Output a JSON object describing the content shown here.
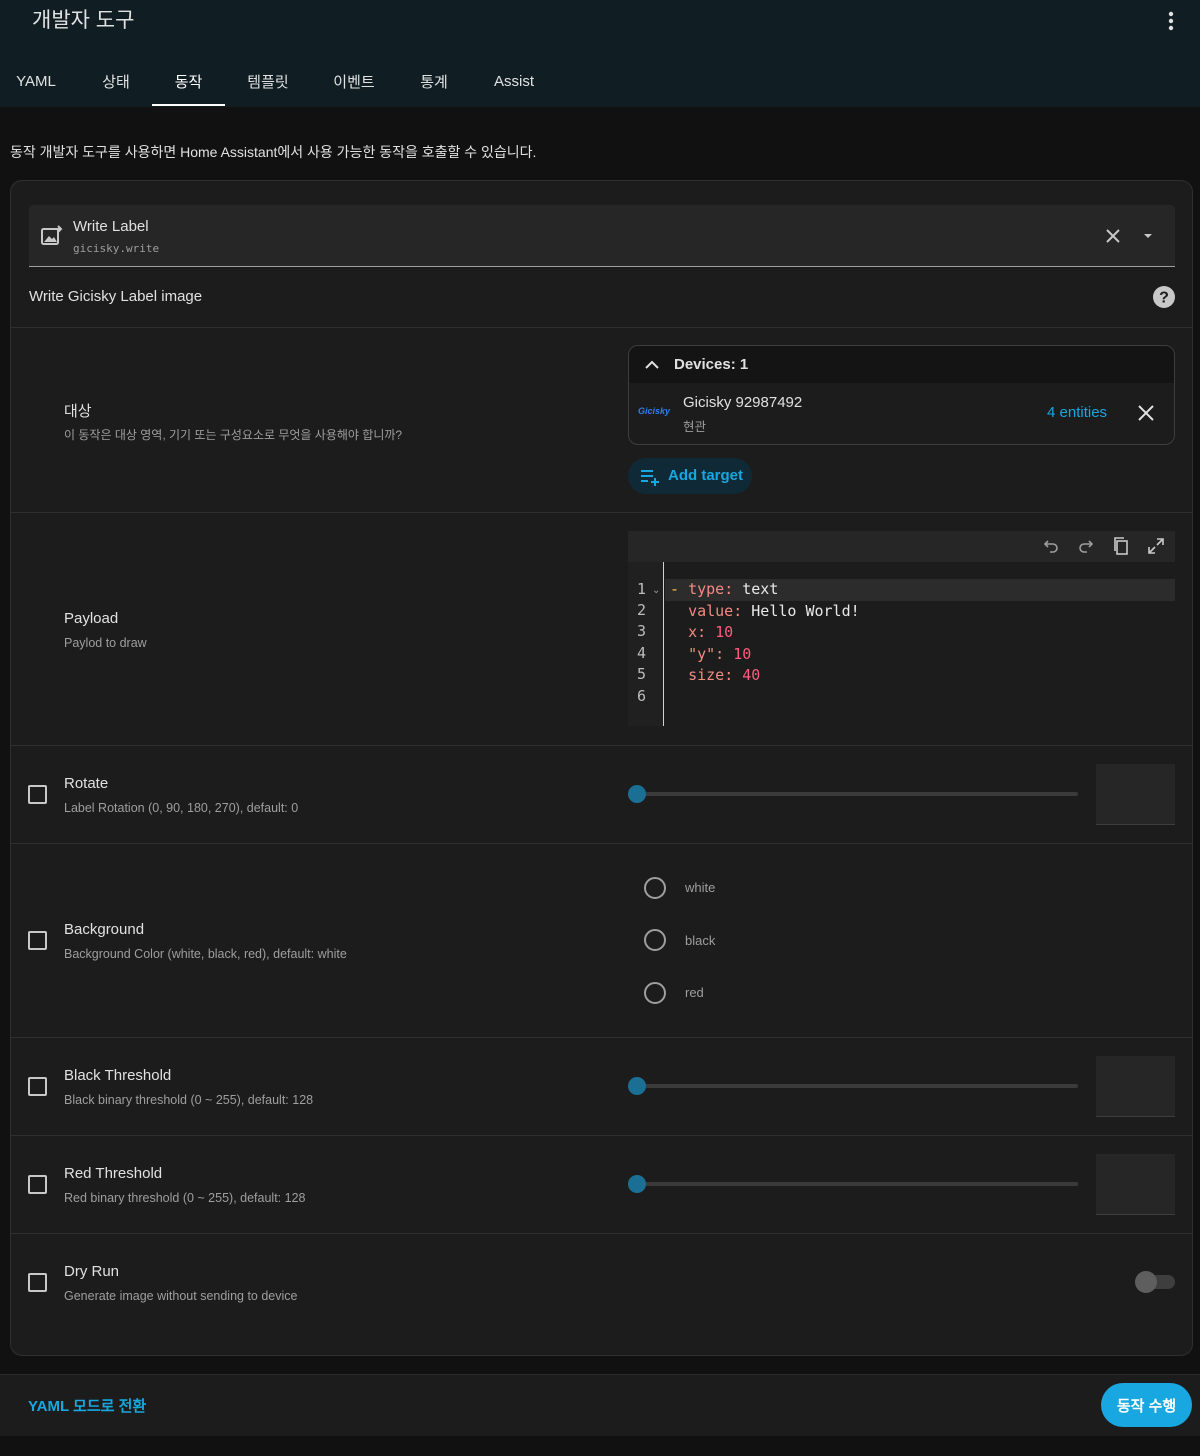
{
  "header": {
    "title": "개발자 도구",
    "menu_icon": "dots-vertical-icon",
    "tabs": [
      "YAML",
      "상태",
      "동작",
      "템플릿",
      "이벤트",
      "통계",
      "Assist"
    ],
    "active_tab": "동작"
  },
  "description": "동작 개발자 도구를 사용하면 Home Assistant에서 사용 가능한 동작을 호출할 수 있습니다.",
  "action_picker": {
    "icon": "image-edit-icon",
    "name": "Write Label",
    "service": "gicisky.write"
  },
  "action_description": "Write Gicisky Label image",
  "target": {
    "label": "대상",
    "description": "이 동작은 대상 영역, 기기 또는 구성요소로 무엇을 사용해야 합니까?",
    "devices_header": "Devices: 1",
    "device": {
      "logo": "Gicisky",
      "name": "Gicisky 92987492",
      "area": "현관",
      "entities": "4 entities"
    },
    "add_target": "Add target"
  },
  "payload": {
    "label": "Payload",
    "description": "Paylod to draw",
    "line_numbers": [
      "1",
      "2",
      "3",
      "4",
      "5",
      "6"
    ],
    "code": [
      {
        "indent": "",
        "dash": "- ",
        "key": "type",
        "value": "text",
        "numeric": false
      },
      {
        "indent": "  ",
        "dash": "",
        "key": "value",
        "value": "Hello World!",
        "numeric": false
      },
      {
        "indent": "  ",
        "dash": "",
        "key": "x",
        "value": "10",
        "numeric": true
      },
      {
        "indent": "  ",
        "dash": "",
        "key": "\"y\"",
        "value": "10",
        "numeric": true
      },
      {
        "indent": "  ",
        "dash": "",
        "key": "size",
        "value": "40",
        "numeric": true
      }
    ]
  },
  "fields": {
    "rotate": {
      "label": "Rotate",
      "description": "Label Rotation (0, 90, 180, 270), default: 0"
    },
    "background": {
      "label": "Background",
      "description": "Background Color (white, black, red), default: white",
      "options": [
        "white",
        "black",
        "red"
      ]
    },
    "black_threshold": {
      "label": "Black Threshold",
      "description": "Black binary threshold (0 ~ 255), default: 128"
    },
    "red_threshold": {
      "label": "Red Threshold",
      "description": "Red binary threshold (0 ~ 255), default: 128"
    },
    "dry_run": {
      "label": "Dry Run",
      "description": "Generate image without sending to device"
    }
  },
  "footer": {
    "yaml_mode": "YAML 모드로 전환",
    "run_button": "동작 수행"
  },
  "colors": {
    "accent": "#18a7e0",
    "header_bg": "#101e24",
    "card_bg": "#1c1c1c"
  }
}
